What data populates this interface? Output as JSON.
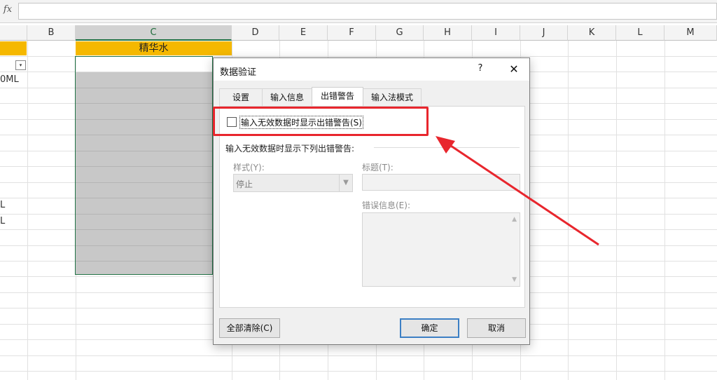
{
  "formula_bar": {
    "fx_label": "fx",
    "value": ""
  },
  "sheet": {
    "columns": [
      {
        "label": ""
      },
      {
        "label": "B"
      },
      {
        "label": "C"
      },
      {
        "label": "D"
      },
      {
        "label": "E"
      },
      {
        "label": "F"
      },
      {
        "label": "G"
      },
      {
        "label": "H"
      },
      {
        "label": "I"
      },
      {
        "label": "J"
      },
      {
        "label": "K"
      },
      {
        "label": "L"
      },
      {
        "label": "M"
      }
    ],
    "header_cell_c": "精华水",
    "filter_icon": "filter-dropdown-icon",
    "column_a_values": [
      "0ML",
      "L",
      "L"
    ]
  },
  "dialog": {
    "title": "数据验证",
    "help": "?",
    "close": "✕",
    "tabs": [
      {
        "label": "设置"
      },
      {
        "label": "输入信息"
      },
      {
        "label": "出错警告"
      },
      {
        "label": "输入法模式"
      }
    ],
    "active_tab": "出错警告",
    "show_error_checkbox": {
      "label": "输入无效数据时显示出错警告(S)",
      "checked": false
    },
    "group_heading": "输入无效数据时显示下列出错警告:",
    "style": {
      "label": "样式(Y):",
      "value": "停止"
    },
    "title_field": {
      "label": "标题(T):",
      "value": ""
    },
    "error_message": {
      "label": "错误信息(E):",
      "value": ""
    },
    "buttons": {
      "clear_all": "全部清除(C)",
      "ok": "确定",
      "cancel": "取消"
    }
  },
  "annotation": {
    "color": "#e8262d"
  },
  "colors": {
    "header_fill": "#f5b800",
    "selection_border": "#217346",
    "dialog_default_button": "#3c7fc4"
  }
}
